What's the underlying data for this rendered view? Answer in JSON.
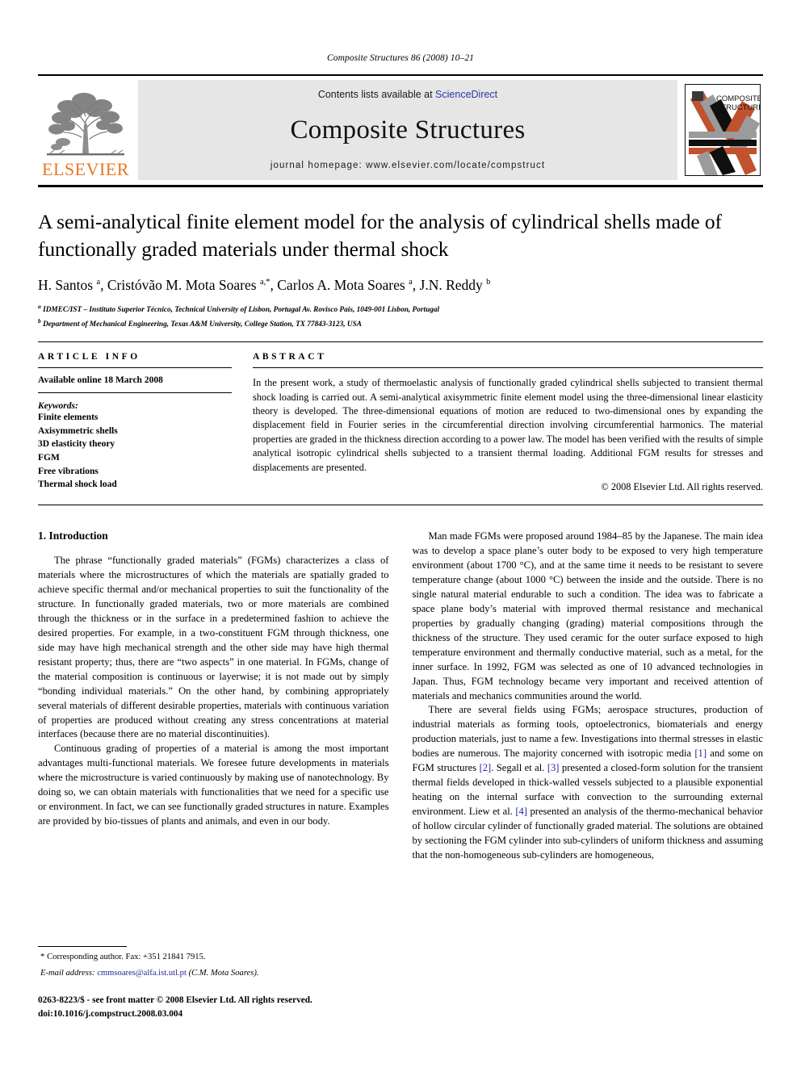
{
  "running_head": "Composite Structures 86 (2008) 10–21",
  "masthead": {
    "publisher_name": "ELSEVIER",
    "contents_prefix": "Contents lists available at ",
    "sciencedirect": "ScienceDirect",
    "journal_name": "Composite Structures",
    "homepage": "journal homepage: www.elsevier.com/locate/compstruct",
    "cover_line1": "COMPOSITE",
    "cover_line2": "STRUCTURES",
    "colors": {
      "elsevier_orange": "#E87722",
      "sciencedirect_blue": "#2b39a8",
      "band_orange": "#C1522F",
      "band_gray": "#9b9b9b",
      "band_black": "#101010",
      "panel_gray": "#e6e6e6"
    }
  },
  "article": {
    "title": "A semi-analytical finite element model for the analysis of cylindrical shells made of functionally graded materials under thermal shock",
    "authors": "H. Santos a, Cristóvão M. Mota Soares a,*, Carlos A. Mota Soares a, J.N. Reddy b",
    "affiliation_a": "IDMEC/IST – Instituto Superior Técnico, Technical University of Lisbon, Portugal Av. Rovisco Pais, 1049-001 Lisbon, Portugal",
    "affiliation_b": "Department of Mechanical Engineering, Texas A&M University, College Station, TX 77843-3123, USA"
  },
  "article_info": {
    "label": "ARTICLE INFO",
    "available_online": "Available online 18 March 2008",
    "keywords_label": "Keywords:",
    "keywords": [
      "Finite elements",
      "Axisymmetric shells",
      "3D elasticity theory",
      "FGM",
      "Free vibrations",
      "Thermal shock load"
    ]
  },
  "abstract": {
    "label": "ABSTRACT",
    "text": "In the present work, a study of thermoelastic analysis of functionally graded cylindrical shells subjected to transient thermal shock loading is carried out. A semi-analytical axisymmetric finite element model using the three-dimensional linear elasticity theory is developed. The three-dimensional equations of motion are reduced to two-dimensional ones by expanding the displacement field in Fourier series in the circumferential direction involving circumferential harmonics. The material properties are graded in the thickness direction according to a power law. The model has been verified with the results of simple analytical isotropic cylindrical shells subjected to a transient thermal loading. Additional FGM results for stresses and displacements are presented.",
    "copyright": "© 2008 Elsevier Ltd. All rights reserved."
  },
  "body": {
    "section_heading": "1. Introduction",
    "left_paragraphs": [
      "The phrase “functionally graded materials” (FGMs) characterizes a class of materials where the microstructures of which the materials are spatially graded to achieve specific thermal and/or mechanical properties to suit the functionality of the structure. In functionally graded materials, two or more materials are combined through the thickness or in the surface in a predetermined fashion to achieve the desired properties. For example, in a two-constituent FGM through thickness, one side may have high mechanical strength and the other side may have high thermal resistant property; thus, there are “two aspects” in one material. In FGMs, change of the material composition is continuous or layerwise; it is not made out by simply “bonding individual materials.” On the other hand, by combining appropriately several materials of different desirable properties, materials with continuous variation of properties are produced without creating any stress concentrations at material interfaces (because there are no material discontinuities).",
      "Continuous grading of properties of a material is among the most important advantages multi-functional materials. We foresee future developments in materials where the microstructure is varied continuously by making use of nanotechnology. By doing so, we can obtain materials with functionalities that we need for a specific use or environment. In fact, we can see functionally graded structures in nature. Examples are provided by bio-tissues of plants and animals, and even in our body."
    ],
    "right_paragraph_1": "Man made FGMs were proposed around 1984–85 by the Japanese. The main idea was to develop a space plane’s outer body to be exposed to very high temperature environment (about 1700 °C), and at the same time it needs to be resistant to severe temperature change (about 1000 °C) between the inside and the outside. There is no single natural material endurable to such a condition. The idea was to fabricate a space plane body’s material with improved thermal resistance and mechanical properties by gradually changing (grading) material compositions through the thickness of the structure. They used ceramic for the outer surface exposed to high temperature environment and thermally conductive material, such as a metal, for the inner surface. In 1992, FGM was selected as one of 10 advanced technologies in Japan. Thus, FGM technology became very important and received attention of materials and mechanics communities around the world.",
    "right_paragraph_2": {
      "part1": "There are several fields using FGMs; aerospace structures, production of industrial materials as forming tools, optoelectronics, biomaterials and energy production materials, just to name a few. Investigations into thermal stresses in elastic bodies are numerous. The majority concerned with isotropic media ",
      "cite1": "[1]",
      "part2": " and some on FGM structures ",
      "cite2": "[2]",
      "part3": ". Segall et al. ",
      "cite3": "[3]",
      "part4": " presented a closed-form solution for the transient thermal fields developed in thick-walled vessels subjected to a plausible exponential heating on the internal surface with convection to the surrounding external environment. Liew et al. ",
      "cite4": "[4]",
      "part5": " presented an analysis of the thermo-mechanical behavior of hollow circular cylinder of functionally graded material. The solutions are obtained by sectioning the FGM cylinder into sub-cylinders of uniform thickness and assuming that the non-homogeneous sub-cylinders are homogeneous,"
    }
  },
  "footnotes": {
    "corresponding": "Corresponding author. Fax: +351 21841 7915.",
    "email_label": "E-mail address:",
    "email": "cmmsoares@alfa.ist.utl.pt",
    "email_owner": "(C.M. Mota Soares)."
  },
  "imprint": {
    "line1": "0263-8223/$ - see front matter © 2008 Elsevier Ltd. All rights reserved.",
    "line2": "doi:10.1016/j.compstruct.2008.03.004"
  }
}
